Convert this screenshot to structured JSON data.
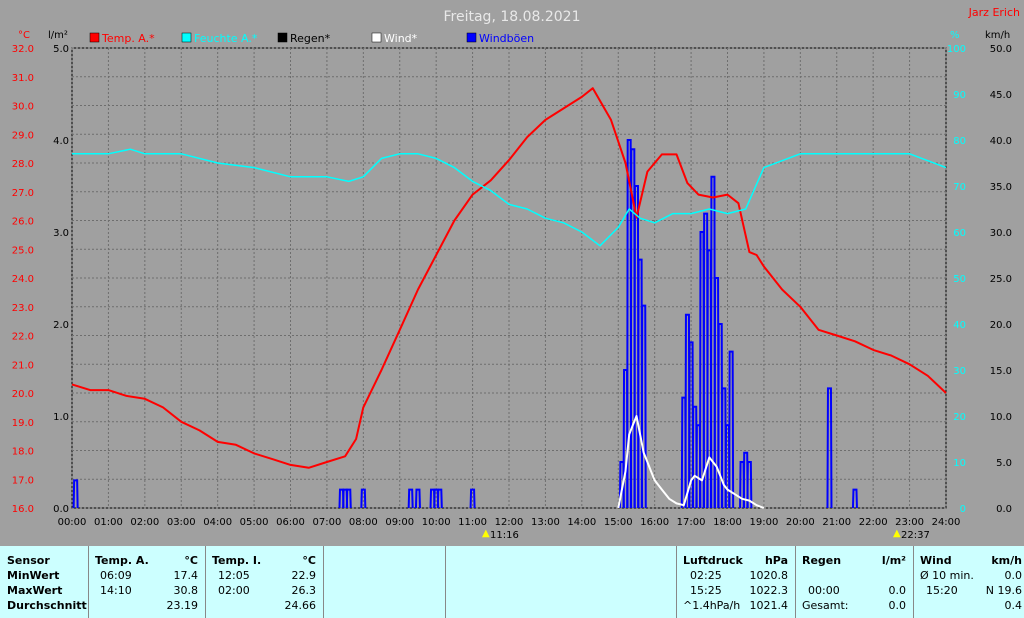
{
  "header": {
    "title": "Freitag, 18.08.2021",
    "credit": "Jarz Erich",
    "left_unit_temp": "°C",
    "left_unit_rain": "l/m²",
    "right_unit_pct": "%",
    "right_unit_wind": "km/h"
  },
  "legend": [
    {
      "label": "Temp. A.*",
      "color": "#ff0000"
    },
    {
      "label": "Feuchte A.*",
      "color": "#00ffff"
    },
    {
      "label": "Regen*",
      "color": "#000000"
    },
    {
      "label": "Wind*",
      "color": "#ffffff"
    },
    {
      "label": "Windböen",
      "color": "#0000ff"
    }
  ],
  "markers": {
    "min_time_label": "11:16",
    "max_time_label": "22:37"
  },
  "chart_data": {
    "type": "line",
    "title": "Freitag, 18.08.2021",
    "x_unit": "hours",
    "xlim": [
      0,
      24
    ],
    "x_tick_labels": [
      "00:00",
      "01:00",
      "02:00",
      "03:00",
      "04:00",
      "05:00",
      "06:00",
      "07:00",
      "08:00",
      "09:00",
      "10:00",
      "11:00",
      "12:00",
      "13:00",
      "14:00",
      "15:00",
      "16:00",
      "17:00",
      "18:00",
      "19:00",
      "20:00",
      "21:00",
      "22:00",
      "23:00",
      "24:00"
    ],
    "axes": {
      "temp": {
        "unit": "°C",
        "lim": [
          16,
          32
        ],
        "ticks": [
          "32.0",
          "31.0",
          "30.0",
          "29.0",
          "28.0",
          "27.0",
          "26.0",
          "25.0",
          "24.0",
          "23.0",
          "22.0",
          "21.0",
          "20.0",
          "19.0",
          "18.0",
          "17.0",
          "16.0"
        ],
        "color": "#ff0000"
      },
      "rain": {
        "unit": "l/m²",
        "lim": [
          0,
          5
        ],
        "ticks": [
          "5.0",
          "4.0",
          "3.0",
          "2.0",
          "1.0",
          "0.0"
        ],
        "color": "#000000"
      },
      "humidity": {
        "unit": "%",
        "lim": [
          0,
          100
        ],
        "ticks": [
          "100",
          "90",
          "80",
          "70",
          "60",
          "50",
          "40",
          "30",
          "20",
          "10",
          "0"
        ],
        "color": "#00ffff"
      },
      "wind": {
        "unit": "km/h",
        "lim": [
          0,
          50
        ],
        "ticks": [
          "50.0",
          "45.0",
          "40.0",
          "35.0",
          "30.0",
          "25.0",
          "20.0",
          "15.0",
          "10.0",
          "5.0",
          "0.0"
        ],
        "color": "#000000"
      }
    },
    "grid": true,
    "legend_position": "top",
    "series": [
      {
        "name": "Temp. A.*",
        "axis": "temp",
        "color": "#ff0000",
        "x": [
          0,
          0.5,
          1,
          1.5,
          2,
          2.5,
          3,
          3.5,
          4,
          4.5,
          5,
          5.5,
          6,
          6.5,
          7,
          7.5,
          7.8,
          8,
          8.5,
          9,
          9.5,
          10,
          10.5,
          11,
          11.5,
          12,
          12.5,
          13,
          13.5,
          14,
          14.3,
          14.8,
          15.2,
          15.5,
          15.8,
          16.2,
          16.6,
          16.9,
          17.2,
          17.6,
          18,
          18.3,
          18.6,
          18.8,
          19,
          19.5,
          20,
          20.5,
          21,
          21.5,
          22,
          22.5,
          23,
          23.5,
          24
        ],
        "y": [
          20.3,
          20.1,
          20.1,
          19.9,
          19.8,
          19.5,
          19.0,
          18.7,
          18.3,
          18.2,
          17.9,
          17.7,
          17.5,
          17.4,
          17.6,
          17.8,
          18.4,
          19.5,
          20.8,
          22.2,
          23.6,
          24.8,
          26.0,
          26.9,
          27.4,
          28.1,
          28.9,
          29.5,
          29.9,
          30.3,
          30.6,
          29.5,
          28.0,
          26.1,
          27.7,
          28.3,
          28.3,
          27.3,
          26.9,
          26.8,
          26.9,
          26.6,
          24.9,
          24.8,
          24.4,
          23.6,
          23.0,
          22.2,
          22.0,
          21.8,
          21.5,
          21.3,
          21.0,
          20.6,
          20.0
        ]
      },
      {
        "name": "Feuchte A.*",
        "axis": "humidity",
        "color": "#00ffff",
        "x": [
          0,
          1,
          1.6,
          2,
          3,
          4,
          5,
          6,
          7,
          7.6,
          8,
          8.5,
          9,
          9.5,
          10,
          10.5,
          11,
          11.5,
          12,
          12.5,
          13,
          13.5,
          14,
          14.5,
          15,
          15.3,
          15.6,
          16,
          16.5,
          17,
          17.5,
          18,
          18.5,
          19,
          20,
          21,
          22,
          23,
          24
        ],
        "y": [
          77,
          77,
          78,
          77,
          77,
          75,
          74,
          72,
          72,
          71,
          72,
          76,
          77,
          77,
          76,
          74,
          71,
          69,
          66,
          65,
          63,
          62,
          60,
          57,
          61,
          65,
          63,
          62,
          64,
          64,
          65,
          64,
          65,
          74,
          77,
          77,
          77,
          77,
          74
        ]
      },
      {
        "name": "Wind*",
        "axis": "wind",
        "color": "#ffffff",
        "x": [
          15,
          15.2,
          15.3,
          15.4,
          15.5,
          15.6,
          15.7,
          15.8,
          15.9,
          16,
          16.2,
          16.4,
          16.6,
          16.8,
          17,
          17.1,
          17.3,
          17.5,
          17.7,
          17.9,
          18,
          18.2,
          18.4,
          18.6,
          18.8,
          19
        ],
        "y": [
          0,
          4,
          8,
          9,
          10,
          8,
          6,
          5,
          4,
          3,
          2,
          1,
          0.5,
          0.3,
          3,
          3.5,
          3,
          5.5,
          4.5,
          2.5,
          2,
          1.5,
          1,
          0.8,
          0.3,
          0
        ]
      },
      {
        "name": "Windböen",
        "axis": "wind",
        "color": "#0000ff",
        "style": "spikes",
        "x": [
          0.1,
          7.4,
          7.5,
          7.6,
          8,
          9.3,
          9.5,
          9.9,
          10,
          10.1,
          11,
          15.1,
          15.2,
          15.3,
          15.4,
          15.5,
          15.6,
          15.7,
          16.8,
          16.9,
          17,
          17.1,
          17.2,
          17.3,
          17.4,
          17.5,
          17.6,
          17.7,
          17.8,
          17.9,
          18,
          18.1,
          18.4,
          18.5,
          18.6,
          20.8,
          21.5
        ],
        "y": [
          3,
          2,
          2,
          2,
          2,
          2,
          2,
          2,
          2,
          2,
          2,
          5,
          15,
          40,
          39,
          35,
          27,
          22,
          12,
          21,
          18,
          11,
          9,
          30,
          32,
          28,
          36,
          25,
          20,
          13,
          9,
          17,
          5,
          6,
          5,
          13,
          2
        ]
      }
    ]
  },
  "stats": {
    "sensor_header": "Sensor",
    "row_labels": [
      "MinWert",
      "MaxWert",
      "Durchschnitt"
    ],
    "temp_a": {
      "header": "Temp. A.",
      "unit": "°C",
      "rows": [
        [
          "06:09",
          "17.4"
        ],
        [
          "14:10",
          "30.8"
        ],
        [
          "",
          "23.19"
        ]
      ]
    },
    "temp_i": {
      "header": "Temp. I.",
      "unit": "°C",
      "rows": [
        [
          "12:05",
          "22.9"
        ],
        [
          "02:00",
          "26.3"
        ],
        [
          "",
          "24.66"
        ]
      ]
    },
    "pressure": {
      "header": "Luftdruck",
      "unit": "hPa",
      "rows": [
        [
          "02:25",
          "1020.8"
        ],
        [
          "15:25",
          "1022.3"
        ],
        [
          "^1.4hPa/h",
          "1021.4"
        ]
      ]
    },
    "rain": {
      "header": "Regen",
      "unit": "l/m²",
      "rows": [
        [
          "",
          ""
        ],
        [
          "00:00",
          "0.0"
        ],
        [
          "Gesamt:",
          "0.0"
        ]
      ]
    },
    "wind": {
      "header": "Wind",
      "unit": "km/h",
      "rows": [
        [
          "Ø 10 min.",
          "0.0"
        ],
        [
          "15:20",
          "N 19.6"
        ],
        [
          "",
          "0.4"
        ]
      ]
    }
  }
}
